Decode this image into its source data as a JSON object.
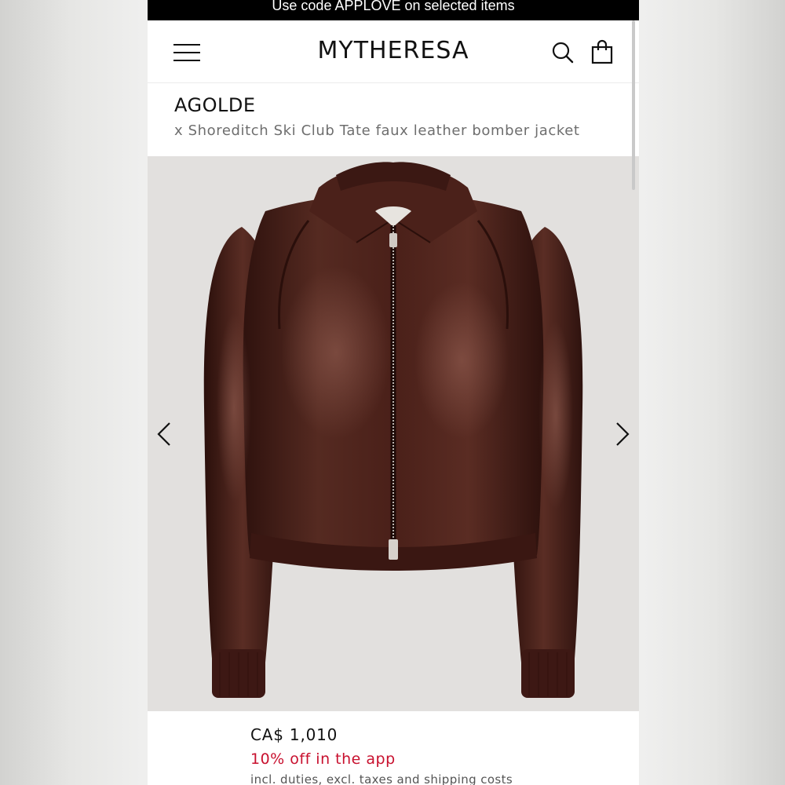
{
  "promo_banner": {
    "text": "Use code APPLOVE on selected items"
  },
  "header": {
    "logo": "MYTHERESA",
    "icons": {
      "menu": "menu-icon",
      "search": "search-icon",
      "bag": "shopping-bag-icon"
    }
  },
  "product": {
    "brand": "AGOLDE",
    "name": "x Shoreditch Ski Club Tate faux leather bomber jacket",
    "price": "CA$ 1,010",
    "promo": "10% off in the app",
    "duties_note": "incl. duties, excl. taxes and shipping costs"
  },
  "gallery": {
    "image": "brown faux leather bomber jacket",
    "prev_icon": "chevron-left-icon",
    "next_icon": "chevron-right-icon"
  },
  "colors": {
    "promo_bg": "#000000",
    "discount_red": "#c8102e",
    "jacket_brown": "#4a1f18",
    "image_bg": "#e2e0de"
  }
}
